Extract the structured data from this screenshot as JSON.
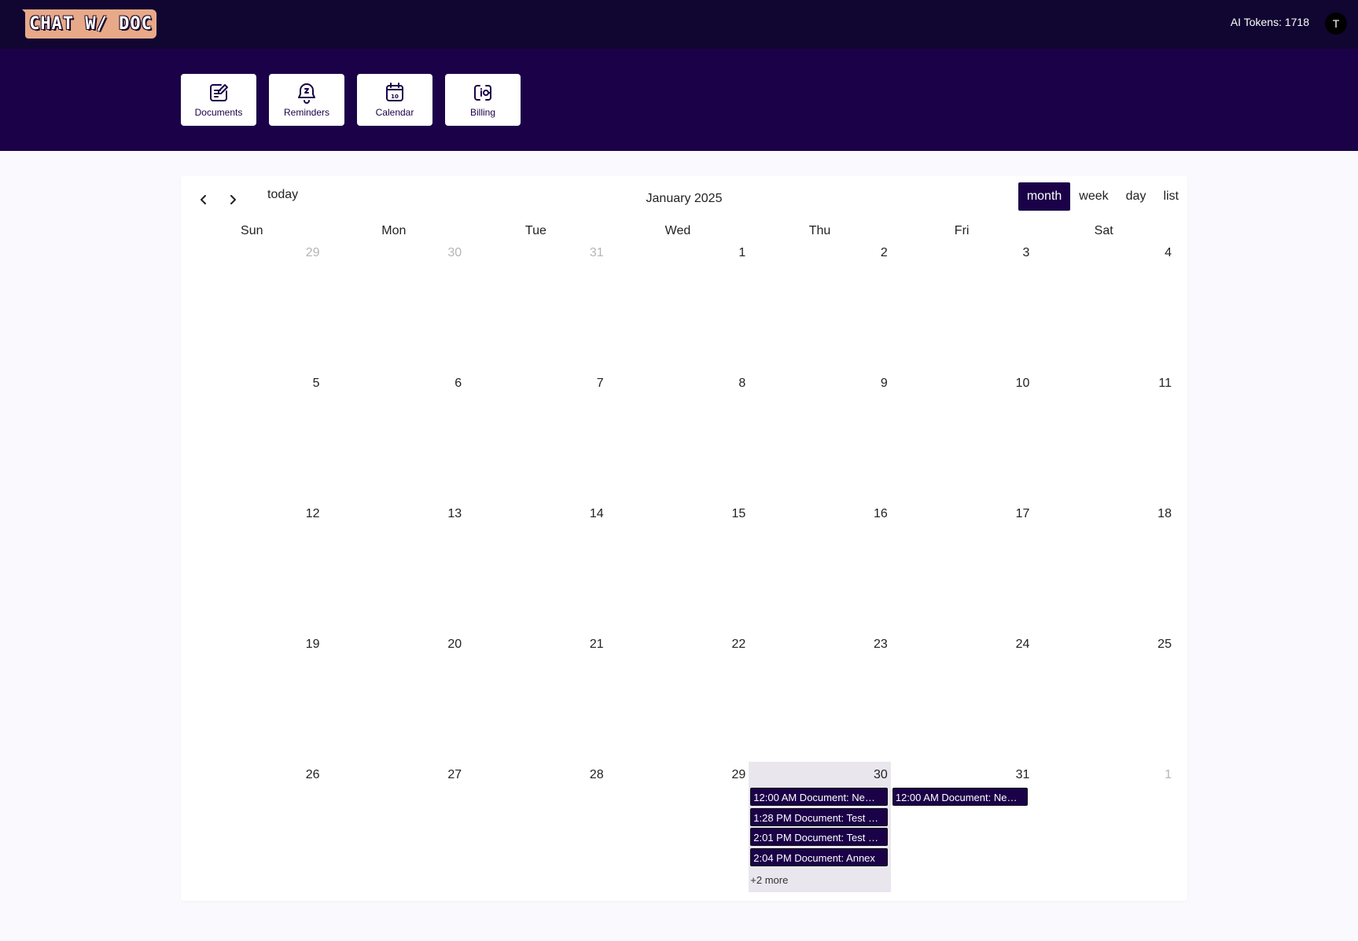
{
  "app": {
    "logo_text": "CHAT W/ DOC",
    "tokens_text": "AI Tokens: 1718",
    "avatar_initial": "T"
  },
  "nav": [
    {
      "label": "Documents",
      "icon": "document-edit-icon"
    },
    {
      "label": "Reminders",
      "icon": "bell-snooze-icon"
    },
    {
      "label": "Calendar",
      "icon": "calendar-icon"
    },
    {
      "label": "Billing",
      "icon": "wallet-icon"
    }
  ],
  "calendar": {
    "title": "January 2025",
    "today_label": "today",
    "views": [
      "month",
      "week",
      "day",
      "list"
    ],
    "active_view": "month",
    "weekdays": [
      "Sun",
      "Mon",
      "Tue",
      "Wed",
      "Thu",
      "Fri",
      "Sat"
    ],
    "weeks": [
      [
        "29",
        "30",
        "31",
        "1",
        "2",
        "3",
        "4"
      ],
      [
        "5",
        "6",
        "7",
        "8",
        "9",
        "10",
        "11"
      ],
      [
        "12",
        "13",
        "14",
        "15",
        "16",
        "17",
        "18"
      ],
      [
        "19",
        "20",
        "21",
        "22",
        "23",
        "24",
        "25"
      ],
      [
        "26",
        "27",
        "28",
        "29",
        "30",
        "31",
        "1"
      ]
    ],
    "other_month_days": [
      "29-0",
      "30-0",
      "31-0",
      "1-4"
    ],
    "today_date": "30",
    "events": {
      "thu_30": [
        "12:00 AM Document: Ne…",
        "1:28 PM Document: Test …",
        "2:01 PM Document: Test …",
        "2:04 PM Document: Annex"
      ],
      "fri_31": [
        "12:00 AM Document: Ne…"
      ],
      "thu_30_more": "+2 more"
    }
  },
  "colors": {
    "topbar": "#110631",
    "navband": "#1b0248",
    "accent": "#1b0248",
    "logo": "#e8a989",
    "today_bg": "#e9e6ee"
  }
}
